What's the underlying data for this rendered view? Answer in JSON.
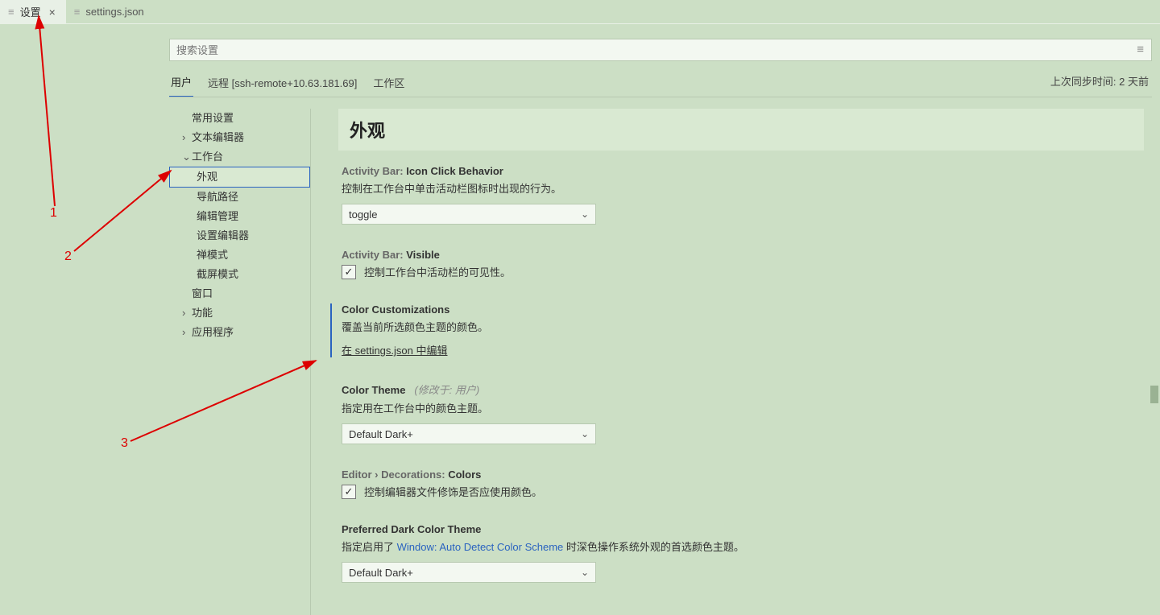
{
  "tabs": [
    {
      "label": "设置",
      "active": true
    },
    {
      "label": "settings.json",
      "active": false
    }
  ],
  "search_placeholder": "搜索设置",
  "scopes": {
    "user": "用户",
    "remote": "远程 [ssh-remote+10.63.181.69]",
    "workspace": "工作区"
  },
  "sync_status": "上次同步时间: 2 天前",
  "nav": {
    "common": "常用设置",
    "text_editor": "文本编辑器",
    "workbench": "工作台",
    "appearance": "外观",
    "breadcrumbs": "导航路径",
    "editor_mgmt": "编辑管理",
    "settings_editor": "设置编辑器",
    "zen": "禅模式",
    "screencast": "截屏模式",
    "window": "窗口",
    "features": "功能",
    "applications": "应用程序"
  },
  "section_title": "外观",
  "settings": {
    "icon_click": {
      "prefix": "Activity Bar: ",
      "key": "Icon Click Behavior",
      "desc": "控制在工作台中单击活动栏图标时出现的行为。",
      "value": "toggle"
    },
    "visible": {
      "prefix": "Activity Bar: ",
      "key": "Visible",
      "desc": "控制工作台中活动栏的可见性。"
    },
    "color_custom": {
      "key": "Color Customizations",
      "desc": "覆盖当前所选颜色主题的颜色。",
      "link": "在 settings.json 中编辑"
    },
    "color_theme": {
      "key": "Color Theme",
      "modifier": "(修改于: 用户)",
      "desc": "指定用在工作台中的颜色主题。",
      "value": "Default Dark+"
    },
    "editor_decor": {
      "prefix": "Editor › Decorations: ",
      "key": "Colors",
      "desc": "控制编辑器文件修饰是否应使用颜色。"
    },
    "pref_dark": {
      "key": "Preferred Dark Color Theme",
      "desc1": "指定启用了 ",
      "link": "Window: Auto Detect Color Scheme",
      "desc2": " 时深色操作系统外观的首选颜色主题。",
      "value": "Default Dark+"
    }
  },
  "annotations": {
    "a1": "1",
    "a2": "2",
    "a3": "3"
  }
}
